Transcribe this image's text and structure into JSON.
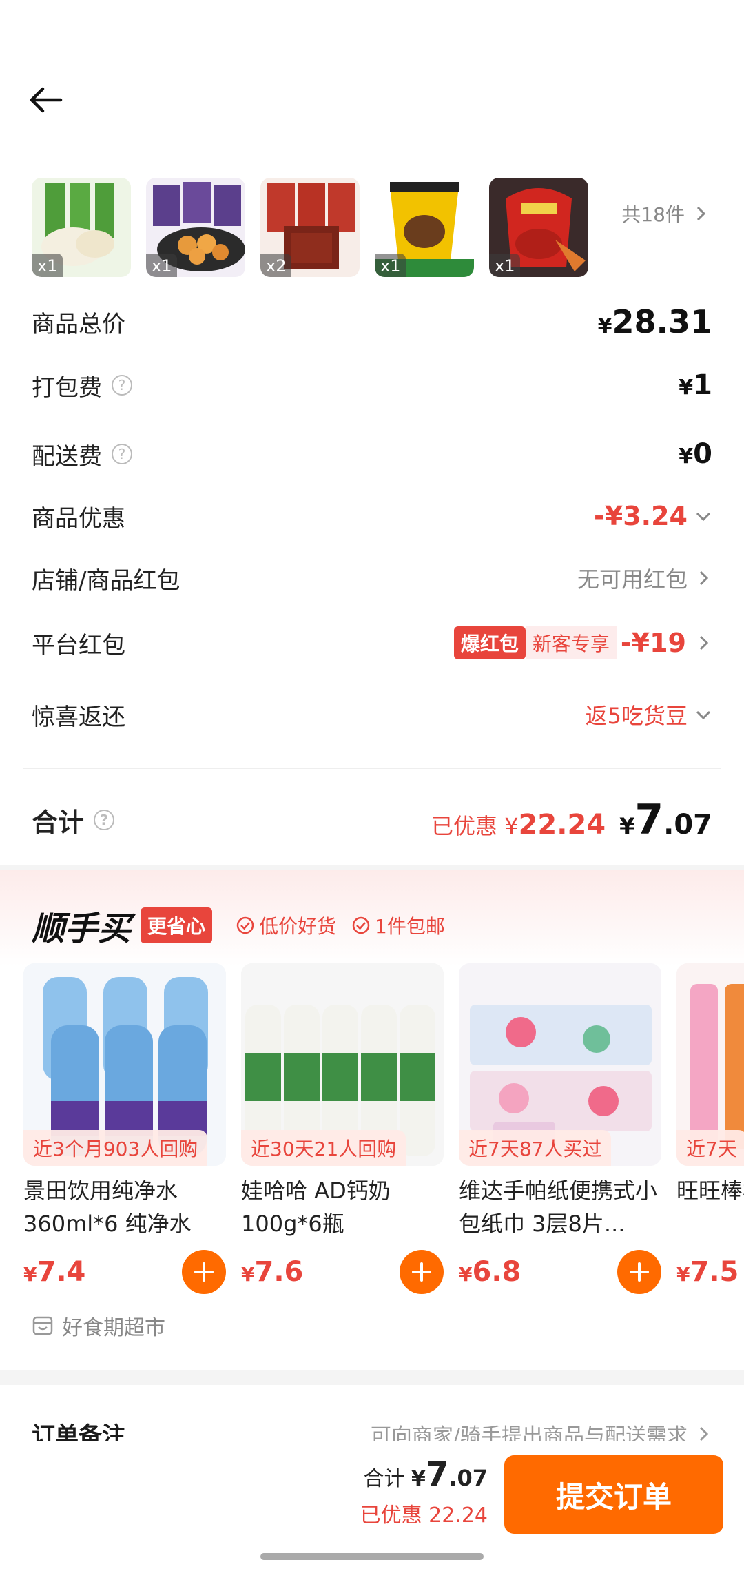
{
  "order_items": {
    "thumbs": [
      {
        "qty": "x1",
        "bg": "#e9f3dd",
        "accent": "#3d8c2e"
      },
      {
        "qty": "x1",
        "bg": "#ece8f2",
        "accent": "#6a4a9a"
      },
      {
        "qty": "x2",
        "bg": "#f6e6e0",
        "accent": "#b0301f"
      },
      {
        "qty": "x1",
        "bg": "#f8f0c8",
        "accent": "#e8b400"
      },
      {
        "qty": "x1",
        "bg": "#f1dad6",
        "accent": "#c8201a"
      }
    ],
    "more_label": "共18件"
  },
  "fees": {
    "goods_total": {
      "label": "商品总价",
      "currency": "¥",
      "value": "28.31"
    },
    "packing": {
      "label": "打包费",
      "currency": "¥",
      "value": "1"
    },
    "delivery": {
      "label": "配送费",
      "currency": "¥",
      "value": "0"
    },
    "goods_discount": {
      "label": "商品优惠",
      "value": "-¥3.24"
    },
    "store_coupon": {
      "label": "店铺/商品红包",
      "value": "无可用红包"
    },
    "platform_coupon": {
      "label": "平台红包",
      "tag": "爆红包",
      "sub_tag": "新客专享",
      "value": "-¥19"
    },
    "surprise": {
      "label": "惊喜返还",
      "value": "返5吃货豆"
    }
  },
  "total": {
    "label": "合计",
    "saved_prefix": "已优惠 ",
    "saved_currency": "¥",
    "saved_value": "22.24",
    "currency": "¥",
    "int_part": "7",
    "dec_part": ".07"
  },
  "recommend": {
    "title": "顺手买",
    "badge": "更省心",
    "features": [
      "低价好货",
      "1件包邮"
    ],
    "cards": [
      {
        "tag": "近3个月903人回购",
        "name": "景田饮用纯净水 360ml*6 纯净水",
        "currency": "¥",
        "price": "7.4"
      },
      {
        "tag": "近30天21人回购",
        "name": "娃哈哈 AD钙奶 100g*6瓶",
        "currency": "¥",
        "price": "7.6"
      },
      {
        "tag": "近7天87人买过",
        "name": "维达手帕纸便携式小包纸巾 3层8片...",
        "currency": "¥",
        "price": "6.8"
      },
      {
        "tag": "近7天",
        "name": "旺旺棒棒冰",
        "currency": "¥",
        "price": "7.5"
      }
    ],
    "store_name": "好食期超市"
  },
  "remark": {
    "label": "订单备注",
    "hint": "可向商家/骑手提出商品与配送需求"
  },
  "bottom_bar": {
    "sum_label": "合计 ",
    "currency": "¥",
    "int_part": "7",
    "dec_part": ".07",
    "saved": "已优惠 22.24",
    "submit_label": "提交订单"
  },
  "colors": {
    "accent_red": "#e8453c",
    "accent_orange": "#ff6a00"
  }
}
